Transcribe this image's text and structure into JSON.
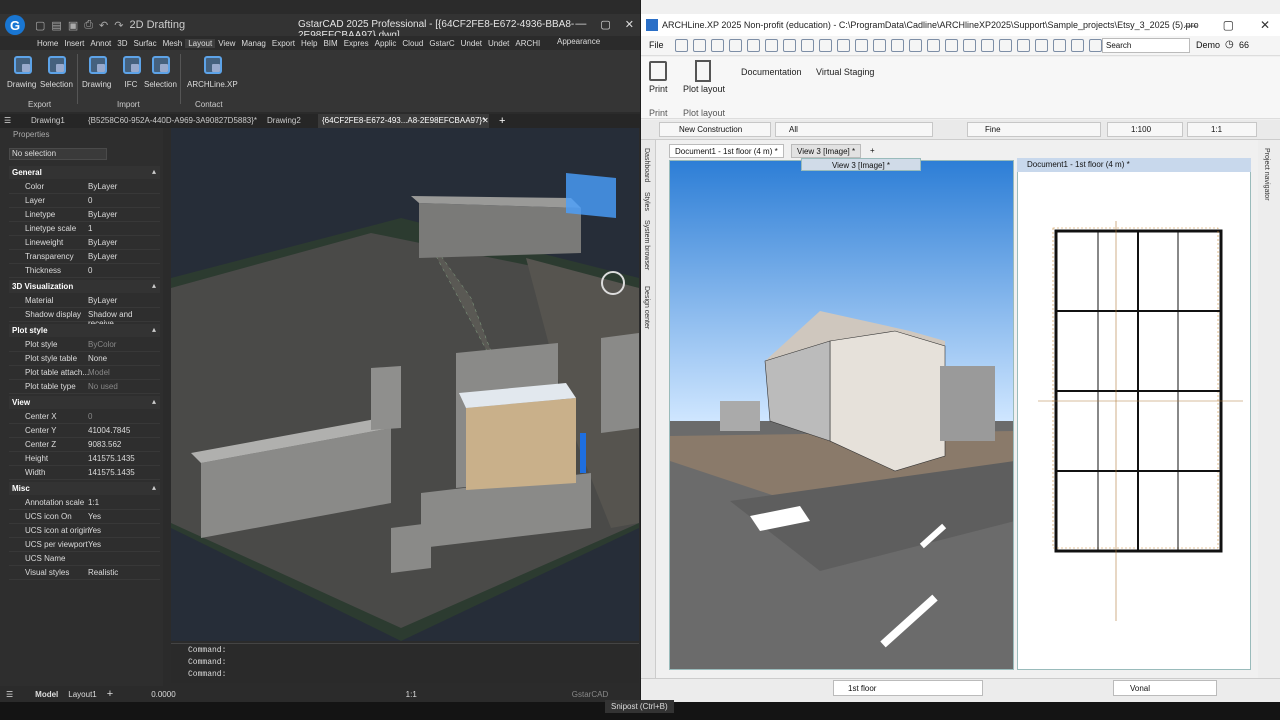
{
  "left": {
    "title": "GstarCAD 2025 Professional - [{64CF2FE8-E672-4936-BBA8-2E98EFCBAA97}.dwg]",
    "workspace": "2D Drafting",
    "menu": [
      "Home",
      "Insert",
      "Annot",
      "3D",
      "Surfac",
      "Mesh",
      "Layout",
      "View",
      "Manag",
      "Export",
      "Help",
      "BIM",
      "Expres",
      "Applic",
      "Cloud",
      "GstarC",
      "Undet",
      "Undet",
      "ARCHI"
    ],
    "appearance": "Appearance",
    "ribbon": {
      "buttons": [
        "Drawing",
        "Selection",
        "Drawing",
        "IFC",
        "Selection",
        "ARCHLine.XP"
      ],
      "groups": [
        "Export",
        "Import",
        "Contact"
      ]
    },
    "doc_tabs": [
      "Drawing1",
      "{B5258C60-952A-440D-A969-3A90827D5883}*",
      "Drawing2",
      "{64CF2FE8-E672-493...A8-2E98EFCBAA97}*"
    ],
    "properties": {
      "header": "Properties",
      "selection": "No selection",
      "sections": [
        {
          "name": "General",
          "rows": [
            [
              "Color",
              "ByLayer"
            ],
            [
              "Layer",
              "0"
            ],
            [
              "Linetype",
              "ByLayer"
            ],
            [
              "Linetype scale",
              "1"
            ],
            [
              "Lineweight",
              "ByLayer"
            ],
            [
              "Transparency",
              "ByLayer"
            ],
            [
              "Thickness",
              "0"
            ]
          ]
        },
        {
          "name": "3D Visualization",
          "rows": [
            [
              "Material",
              "ByLayer"
            ],
            [
              "Shadow display",
              "Shadow and receive..."
            ]
          ]
        },
        {
          "name": "Plot style",
          "rows": [
            [
              "Plot style",
              "ByColor"
            ],
            [
              "Plot style table",
              "None"
            ],
            [
              "Plot table attach...",
              "Model"
            ],
            [
              "Plot table type",
              "No used"
            ]
          ]
        },
        {
          "name": "View",
          "rows": [
            [
              "Center X",
              "0"
            ],
            [
              "Center Y",
              "41004.7845"
            ],
            [
              "Center Z",
              "9083.562"
            ],
            [
              "Height",
              "141575.1435"
            ],
            [
              "Width",
              "141575.1435"
            ]
          ]
        },
        {
          "name": "Misc",
          "rows": [
            [
              "Annotation scale",
              "1:1"
            ],
            [
              "UCS icon On",
              "Yes"
            ],
            [
              "UCS icon at origin",
              "Yes"
            ],
            [
              "UCS per viewport",
              "Yes"
            ],
            [
              "UCS Name",
              ""
            ],
            [
              "Visual styles",
              "Realistic"
            ]
          ]
        }
      ]
    },
    "commands": [
      "Command:",
      "Command:",
      "Command:"
    ],
    "status": {
      "model": "Model",
      "layout": "Layout1",
      "coord": "0.0000",
      "scale": "1:1",
      "brand": "GstarCAD"
    }
  },
  "right": {
    "title": "ARCHLine.XP 2025 Non-profit (education) - C:\\ProgramData\\Cadline\\ARCHlineXP2025\\Support\\Sample_projects\\Etsy_3_2025 (5).pro",
    "file": "File",
    "search": "Search",
    "demo": "Demo",
    "demo_count": "66",
    "ribbon": {
      "print": "Print",
      "plot_layout": "Plot layout",
      "documentation": "Documentation",
      "virtual_staging": "Virtual Staging",
      "groups": [
        "Print",
        "Plot layout"
      ]
    },
    "toolbar": {
      "construction": "New Construction",
      "all": "All",
      "fine": "Fine",
      "scale": "1:100",
      "ratio": "1:1"
    },
    "side_tabs": [
      "Dashboard",
      "Styles",
      "System browser",
      "Design center"
    ],
    "right_tab": "Project navigator",
    "tabs": [
      "Document1 - 1st floor (4 m) *",
      "View 3 [Image] *",
      "+"
    ],
    "view3_header": "View 3 [Image] *",
    "doc1_header": "Document1 - 1st floor (4 m) *",
    "status": {
      "floor": "1st floor",
      "layer": "Vonal"
    }
  },
  "tooltip": "Snipost (Ctrl+B)"
}
